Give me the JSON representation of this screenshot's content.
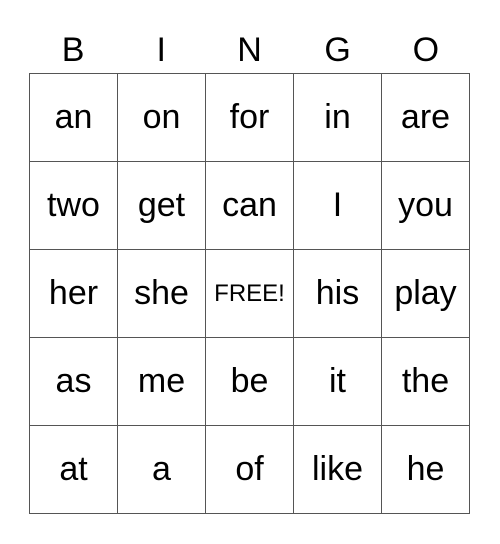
{
  "header": [
    "B",
    "I",
    "N",
    "G",
    "O"
  ],
  "rows": [
    [
      "an",
      "on",
      "for",
      "in",
      "are"
    ],
    [
      "two",
      "get",
      "can",
      "I",
      "you"
    ],
    [
      "her",
      "she",
      "FREE!",
      "his",
      "play"
    ],
    [
      "as",
      "me",
      "be",
      "it",
      "the"
    ],
    [
      "at",
      "a",
      "of",
      "like",
      "he"
    ]
  ]
}
